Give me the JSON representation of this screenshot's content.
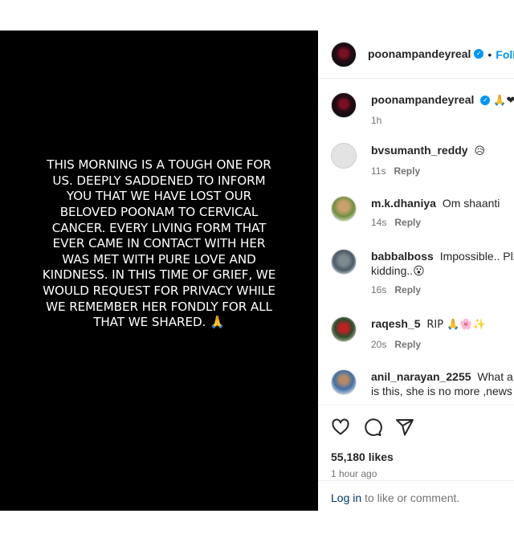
{
  "story_text": "This morning is a tough one for us. Deeply saddened to inform you that we have lost our beloved Poonam to cervical cancer. Every living form that ever came in contact with her was met with pure love and kindness. In this time of grief, we would request for privacy while we remember her fondly for all that we shared. 🙏",
  "header": {
    "username": "poonampandeyreal",
    "separator": "•",
    "follow_label": "Foll"
  },
  "caption": {
    "username": "poonampandeyreal",
    "text": "🙏❤",
    "time": "1h"
  },
  "reply_label": "Reply",
  "comments": [
    {
      "username": "bvsumanth_reddy",
      "text": "😥",
      "time": "11s"
    },
    {
      "username": "m.k.dhaniya",
      "text": "Om shaanti",
      "time": "14s"
    },
    {
      "username": "babbalboss",
      "text": "Impossible.. Plz c",
      "text2": "kidding..😮",
      "time": "16s"
    },
    {
      "username": "raqesh_5",
      "text": "RIP 🙏🌸✨",
      "time": "20s"
    },
    {
      "username": "anil_narayan_2255",
      "text": "What a co",
      "text2": "is this, she is no more ,news i"
    }
  ],
  "likes": "55,180 likes",
  "posted": "1 hour ago",
  "login": {
    "link": "Log in",
    "rest": " to like or comment."
  }
}
